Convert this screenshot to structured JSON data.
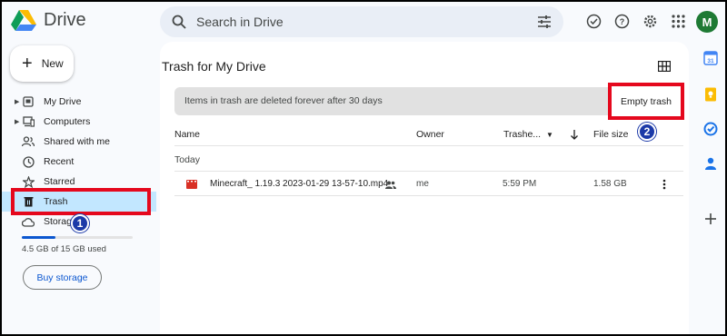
{
  "app": {
    "name": "Drive"
  },
  "search": {
    "placeholder": "Search in Drive"
  },
  "user": {
    "avatar_letter": "M",
    "avatar_color": "#1e7a34"
  },
  "sidebar": {
    "new_label": "New",
    "items": [
      {
        "label": "My Drive",
        "icon": "my-drive-icon",
        "expandable": true
      },
      {
        "label": "Computers",
        "icon": "computers-icon",
        "expandable": true
      },
      {
        "label": "Shared with me",
        "icon": "shared-icon",
        "expandable": false
      },
      {
        "label": "Recent",
        "icon": "clock-icon",
        "expandable": false
      },
      {
        "label": "Starred",
        "icon": "star-icon",
        "expandable": false
      },
      {
        "label": "Trash",
        "icon": "trash-icon",
        "expandable": false,
        "active": true
      },
      {
        "label": "Storage",
        "icon": "cloud-icon",
        "expandable": false
      }
    ],
    "storage_used": "4.5 GB of 15 GB used",
    "storage_fraction": 0.3,
    "buy_label": "Buy storage"
  },
  "main": {
    "title": "Trash for My Drive",
    "notice": "Items in trash are deleted forever after 30 days",
    "empty_trash_label": "Empty trash",
    "columns": {
      "name": "Name",
      "owner": "Owner",
      "trashed": "Trashe...",
      "size": "File size"
    },
    "section_label": "Today",
    "files": [
      {
        "name": "Minecraft_ 1.19.3 2023-01-29 13-57-10.mp4",
        "owner": "me",
        "trashed": "5:59 PM",
        "size": "1.58 GB",
        "shared": true,
        "type": "video"
      }
    ]
  },
  "annotations": {
    "badge1": "1",
    "badge2": "2",
    "highlight_color": "#e5081d",
    "badge_color": "#1c3aa8"
  },
  "colors": {
    "accent": "#0b57d0",
    "active_nav": "#c2e7ff",
    "video_red": "#d93025"
  }
}
